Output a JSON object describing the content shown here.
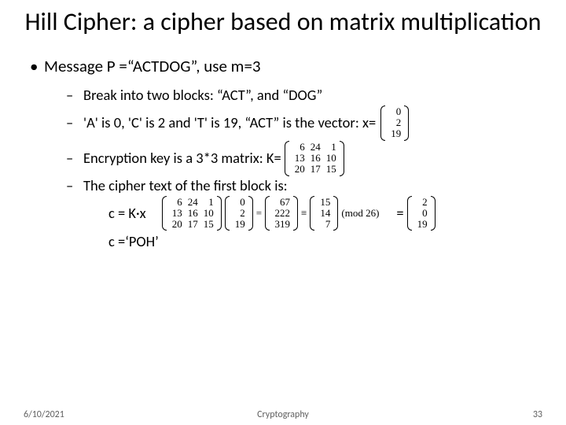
{
  "title": "Hill Cipher:  a cipher based on matrix multiplication",
  "l1": "Message  P =“ACTDOG”, use m=3",
  "items": [
    "Break into two blocks:  “ACT”, and “DOG”",
    "'A' is 0, 'C' is 2 and 'T' is 19, “ACT” is the vector: x=",
    "Encryption key is a 3*3 matrix:  K=",
    "The cipher text of the first block is:"
  ],
  "sub1": "c = K·x",
  "sub2": "c =‘POH’",
  "vec_x": [
    "0",
    "2",
    "19"
  ],
  "K": [
    [
      "6",
      "24",
      "1"
    ],
    [
      "13",
      "16",
      "10"
    ],
    [
      "20",
      "17",
      "15"
    ]
  ],
  "Kx_raw": [
    "67",
    "222",
    "319"
  ],
  "equiv": "≡",
  "mod_label": "(mod 26)",
  "Kx_mod": [
    "15",
    "14",
    "7"
  ],
  "eq": "=",
  "result": [
    "2",
    "0",
    "19"
  ],
  "footer": {
    "date": "6/10/2021",
    "center": "Cryptography",
    "page": "33"
  },
  "chart_data": {
    "type": "table",
    "title": "Hill cipher example, m=3",
    "plaintext": "ACTDOG",
    "block1": "ACT",
    "block2": "DOG",
    "letter_values": {
      "A": 0,
      "C": 2,
      "T": 19
    },
    "x_vector": [
      0,
      2,
      19
    ],
    "K_matrix": [
      [
        6,
        24,
        1
      ],
      [
        13,
        16,
        10
      ],
      [
        20,
        17,
        15
      ]
    ],
    "Kx_product": [
      67,
      222,
      319
    ],
    "modulus": 26,
    "Kx_mod26": [
      15,
      14,
      7
    ],
    "ciphertext_vector_shown": [
      2,
      0,
      19
    ],
    "ciphertext_block1": "POH"
  }
}
